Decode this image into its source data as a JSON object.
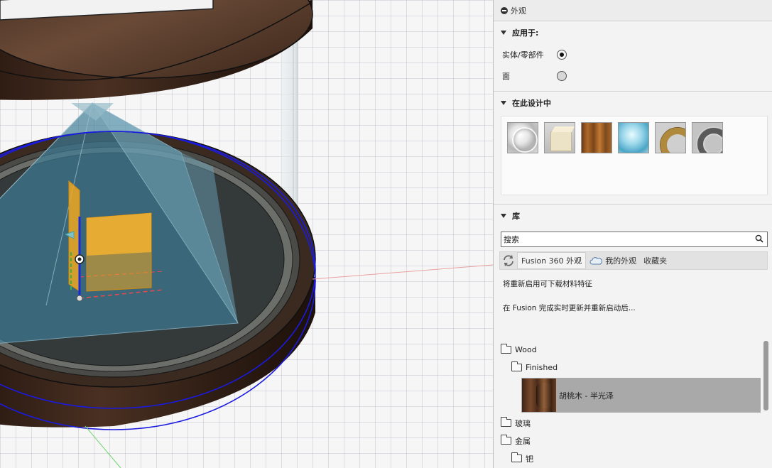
{
  "panel": {
    "title": "外观",
    "apply_section": {
      "header": "应用于:",
      "options": [
        {
          "label": "实体/零部件",
          "selected": true
        },
        {
          "label": "面",
          "selected": false
        }
      ]
    },
    "design_section": {
      "header": "在此设计中",
      "swatches": [
        "chrome-sphere",
        "cream-cube",
        "wood-block",
        "glass-sphere",
        "gold-ring",
        "steel-ring"
      ]
    },
    "library_section": {
      "header": "库",
      "search_placeholder": "搜索",
      "tabs": [
        "Fusion 360 外观",
        "我的外观",
        "收藏夹"
      ],
      "info_line1": "将重新启用可下载材料特征",
      "info_line2": "在 Fusion 完成实时更新并重新启动后..."
    },
    "tree": {
      "wood": "Wood",
      "finished": "Finished",
      "selected_item": "胡桃木 - 半光泽",
      "glass": "玻璃",
      "metal": "金属",
      "palladium": "钯"
    }
  },
  "colors": {
    "accent_selection": "#a9a9a9",
    "grid": "#d4d4e0",
    "sketch_blue": "#1a1ae0",
    "gizmo_orange": "#f0a820"
  }
}
